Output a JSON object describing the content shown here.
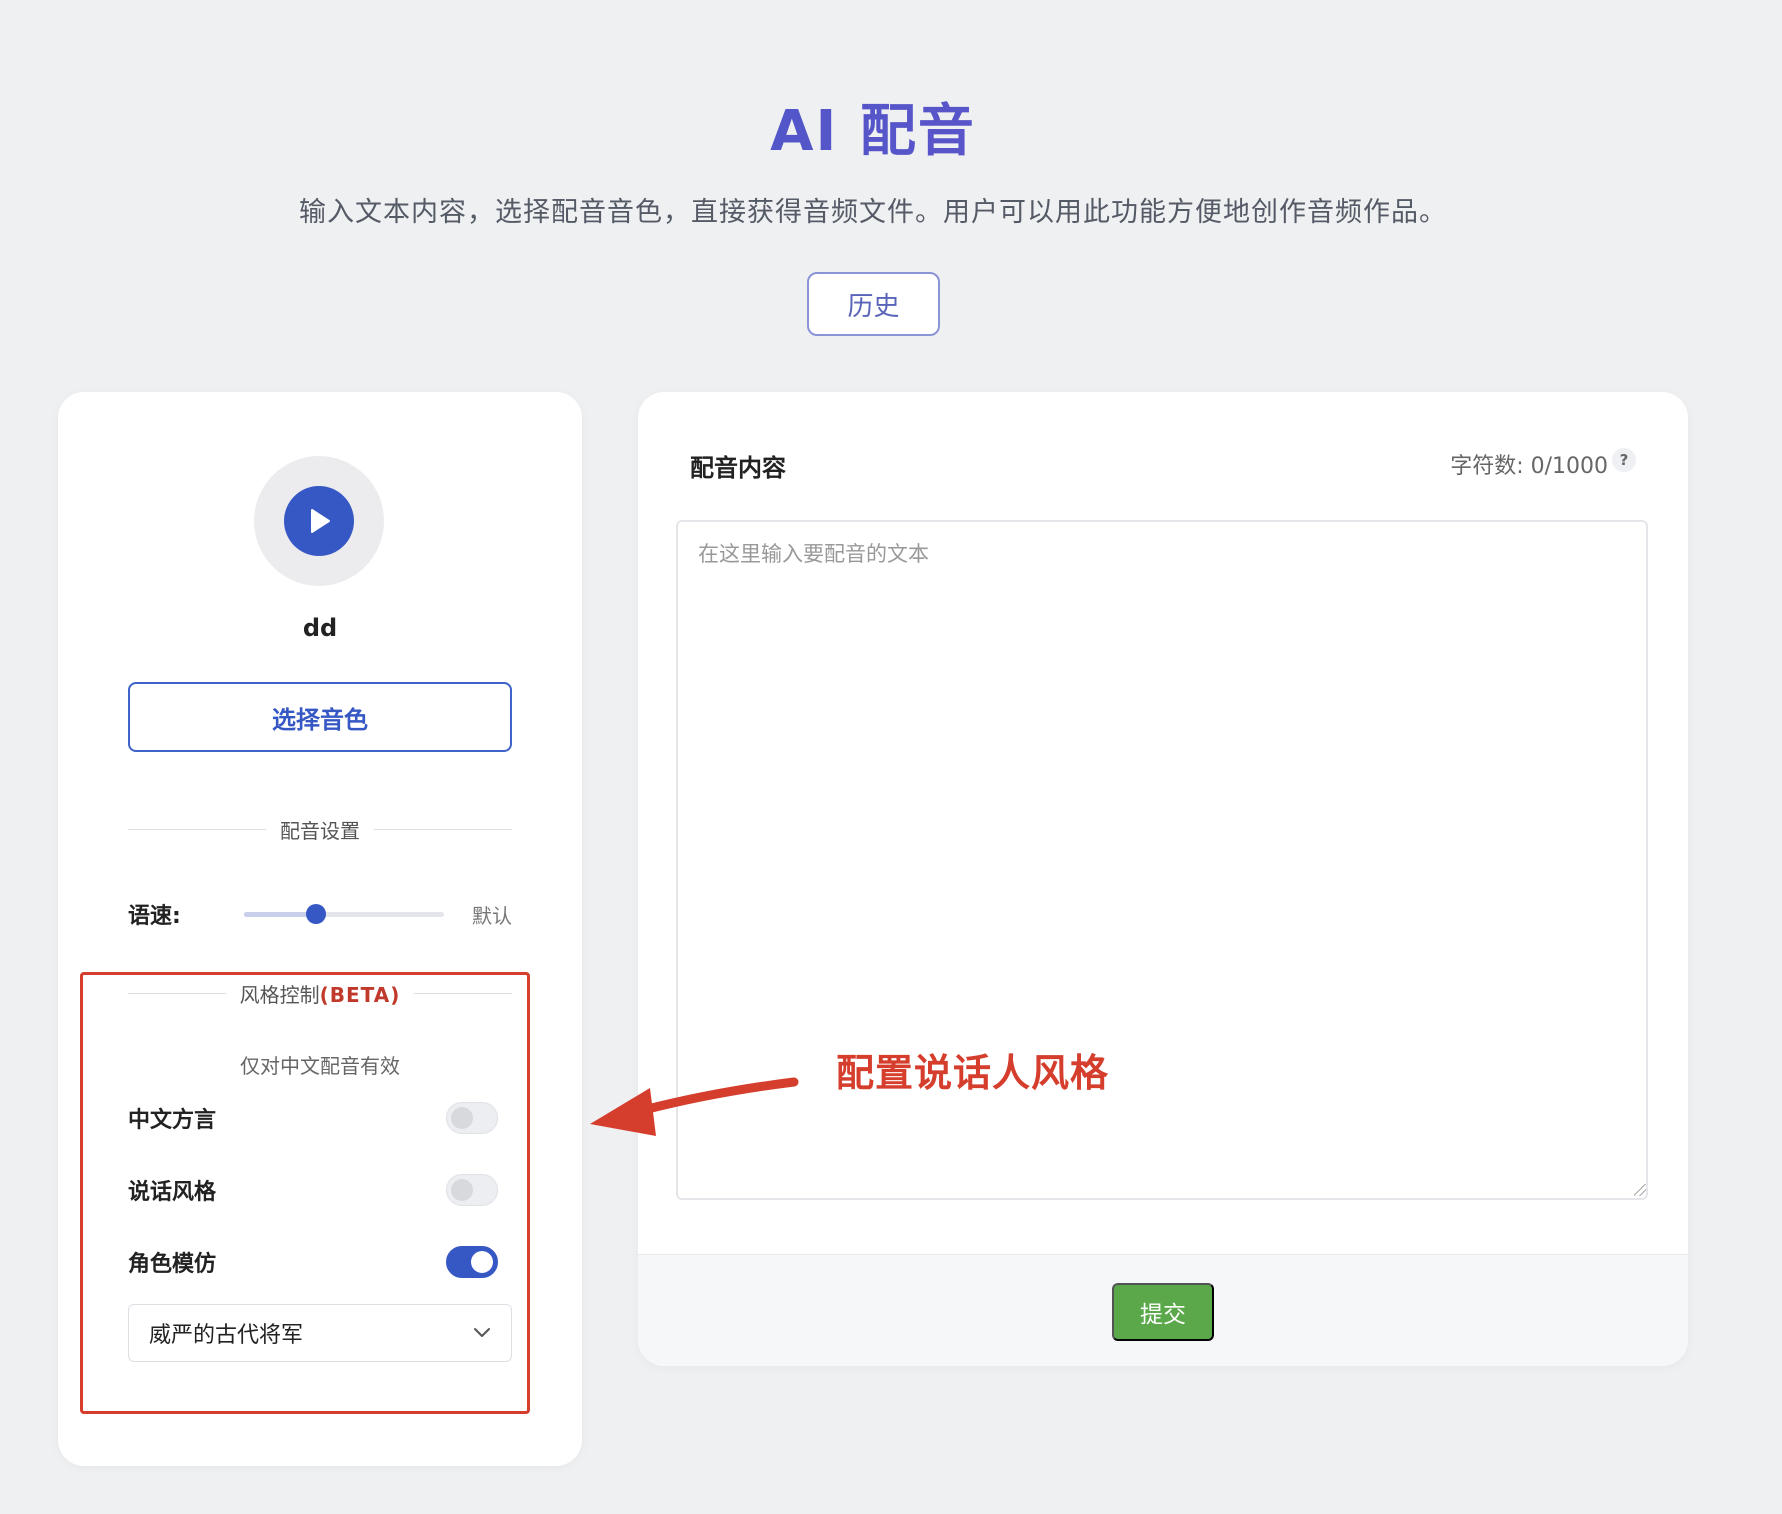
{
  "header": {
    "title": "AI 配音",
    "subtitle": "输入文本内容，选择配音音色，直接获得音频文件。用户可以用此功能方便地创作音频作品。",
    "history_label": "历史"
  },
  "voice": {
    "name": "dd",
    "choose_label": "选择音色"
  },
  "settings": {
    "section_label": "配音设置",
    "speed_label": "语速:",
    "speed_value_label": "默认",
    "speed_level": 0.36
  },
  "style": {
    "section_label": "风格控制",
    "beta_label": "(BETA)",
    "note": "仅对中文配音有效",
    "toggles": [
      {
        "label": "中文方言",
        "on": false
      },
      {
        "label": "说话风格",
        "on": false
      },
      {
        "label": "角色模仿",
        "on": true
      }
    ],
    "role_select_value": "威严的古代将军"
  },
  "content": {
    "title": "配音内容",
    "char_count": "字符数: 0/1000",
    "help_symbol": "?",
    "placeholder": "在这里输入要配音的文本",
    "submit_label": "提交"
  },
  "annotation": {
    "text": "配置说话人风格"
  },
  "colors": {
    "primary": "#3658c4",
    "annotation": "#d53d2c",
    "submit": "#5aa84a"
  }
}
